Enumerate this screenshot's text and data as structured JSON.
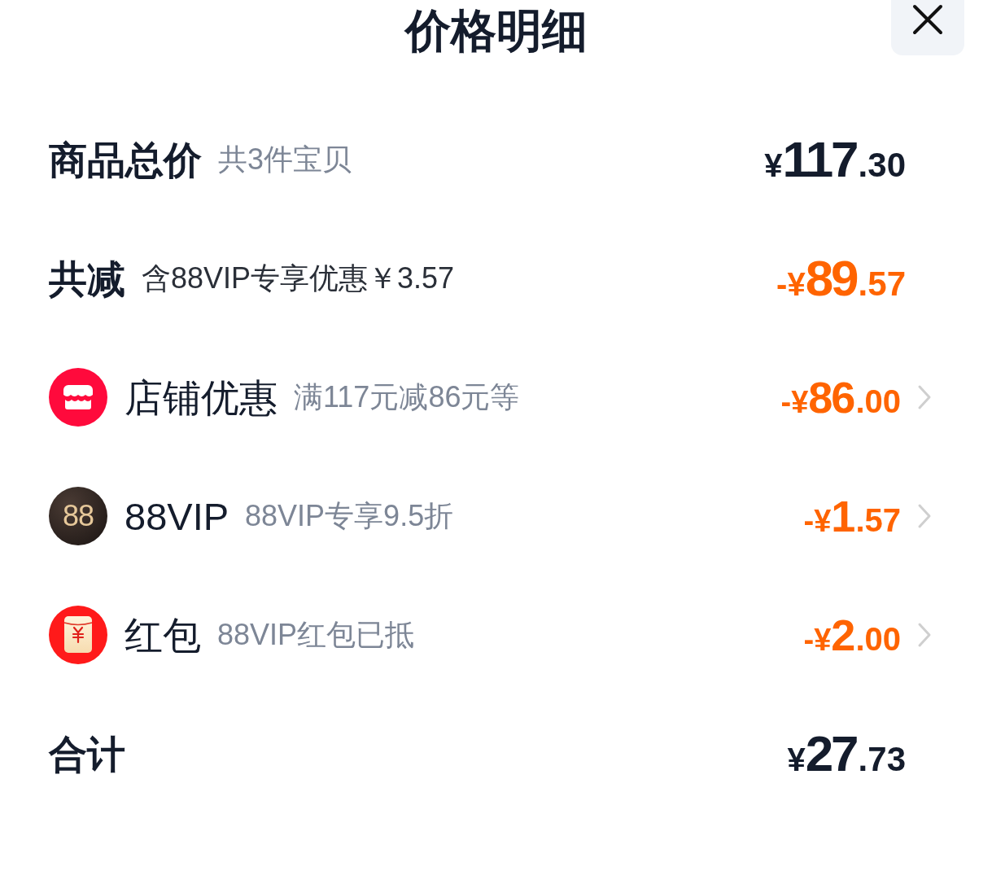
{
  "header": {
    "title": "价格明细"
  },
  "rows": [
    {
      "kind": "subtotal",
      "title": "商品总价",
      "note": "共3件宝贝",
      "amount": {
        "prefix": "¥",
        "whole": "117",
        "fraction": ".30"
      }
    },
    {
      "kind": "total_discount",
      "title": "共减",
      "note": "含88VIP专享优惠￥3.57",
      "amount": {
        "prefix": "-¥",
        "whole": "89",
        "fraction": ".57"
      }
    },
    {
      "kind": "shop_discount",
      "title": "店铺优惠",
      "note": "满117元减86元等",
      "amount": {
        "prefix": "-¥",
        "whole": "86",
        "fraction": ".00"
      }
    },
    {
      "kind": "vip_discount",
      "logo_text": "88",
      "title": "88VIP",
      "note": "88VIP专享9.5折",
      "amount": {
        "prefix": "-¥",
        "whole": "1",
        "fraction": ".57"
      }
    },
    {
      "kind": "red_packet",
      "title": "红包",
      "note": "88VIP红包已抵",
      "amount": {
        "prefix": "-¥",
        "whole": "2",
        "fraction": ".00"
      }
    },
    {
      "kind": "total",
      "title": "合计",
      "amount": {
        "prefix": "¥",
        "whole": "27",
        "fraction": ".73"
      }
    }
  ]
}
